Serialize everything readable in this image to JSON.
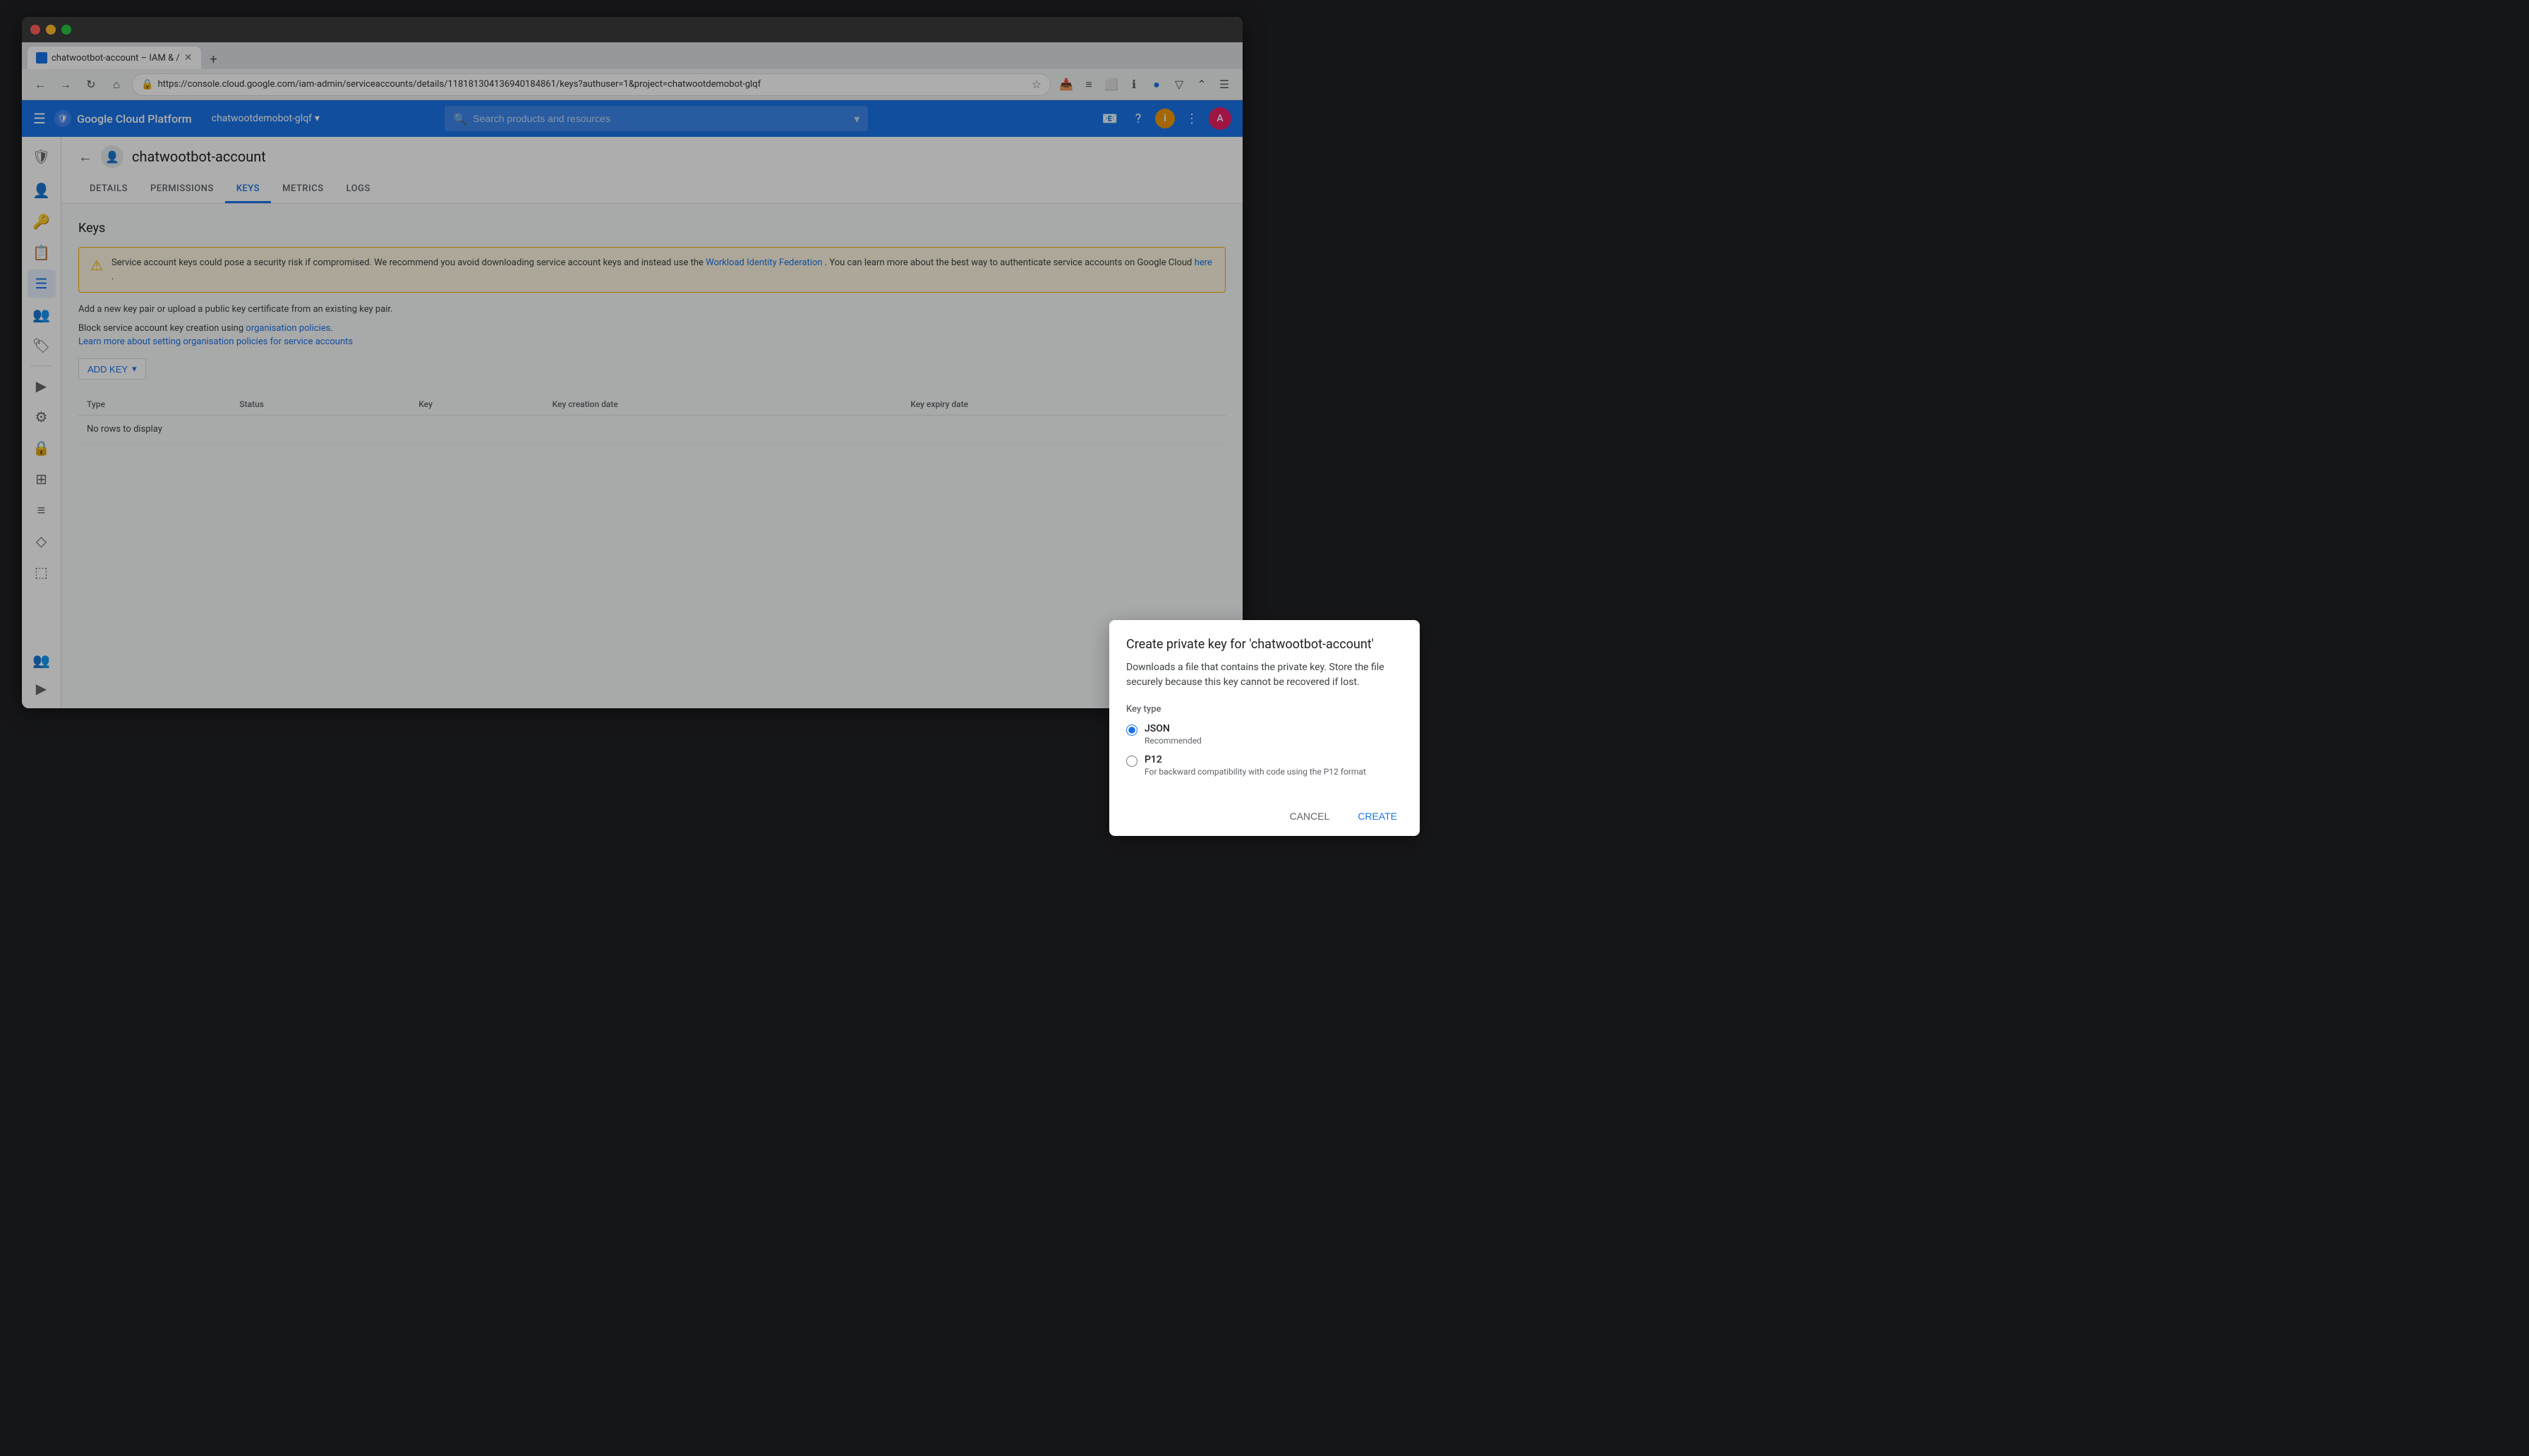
{
  "browser": {
    "tab_title": "chatwootbot-account – IAM &  /",
    "url": "https://console.cloud.google.com/iam-admin/serviceaccounts/details/118181304136940184861/keys?authuser=1&project=chatwootdemobot-glqf"
  },
  "topnav": {
    "app_name": "Google Cloud Platform",
    "project_name": "chatwootdemobot-glqf",
    "search_placeholder": "Search products and resources",
    "hamburger_label": "☰"
  },
  "page": {
    "title": "chatwootbot-account",
    "back_label": "←"
  },
  "tabs": {
    "items": [
      {
        "id": "details",
        "label": "DETAILS"
      },
      {
        "id": "permissions",
        "label": "PERMISSIONS"
      },
      {
        "id": "keys",
        "label": "KEYS"
      },
      {
        "id": "metrics",
        "label": "METRICS"
      },
      {
        "id": "logs",
        "label": "LOGS"
      }
    ],
    "active": "keys"
  },
  "keys_page": {
    "title": "Keys",
    "warning_text": "Service account keys could pose a security risk if compromised. We recommend you avoid downloading service account keys and instead use the ",
    "workload_identity_link": "Workload Identity Federation",
    "warning_text2": ". You can learn more about the best way to authenticate service accounts on Google Cloud ",
    "here_link": "here",
    "warning_text3": ".",
    "add_key_desc": "Add a new key pair or upload a public key certificate from an existing key pair.",
    "block_policy_text": "Block service account key creation using ",
    "org_policy_link": "organisation policies",
    "learn_more_text": "Learn more about setting organisation policies for service accounts",
    "add_key_label": "ADD KEY",
    "table_columns": [
      "Type",
      "Status",
      "Key",
      "Key creation date",
      "Key expiry date"
    ],
    "no_rows_text": "No rows to display"
  },
  "dialog": {
    "title": "Create private key for 'chatwootbot-account'",
    "description": "Downloads a file that contains the private key. Store the file securely because this key cannot be recovered if lost.",
    "key_type_label": "Key type",
    "options": [
      {
        "id": "json",
        "label": "JSON",
        "hint": "Recommended",
        "selected": true
      },
      {
        "id": "p12",
        "label": "P12",
        "hint": "For backward compatibility with code using the P12 format",
        "selected": false
      }
    ],
    "cancel_label": "CANCEL",
    "create_label": "CREATE"
  },
  "sidebar": {
    "icons": [
      {
        "id": "iam",
        "symbol": "🛡",
        "active": true
      },
      {
        "id": "account",
        "symbol": "👤"
      },
      {
        "id": "key",
        "symbol": "🔑"
      },
      {
        "id": "document",
        "symbol": "📄"
      },
      {
        "id": "list",
        "symbol": "☰"
      },
      {
        "id": "people",
        "symbol": "👥"
      },
      {
        "id": "tag",
        "symbol": "🏷"
      },
      {
        "id": "arrow",
        "symbol": "▶"
      },
      {
        "id": "settings",
        "symbol": "⚙"
      },
      {
        "id": "security",
        "symbol": "🔒"
      },
      {
        "id": "grid",
        "symbol": "⊞"
      },
      {
        "id": "layers",
        "symbol": "≡"
      },
      {
        "id": "diamond",
        "symbol": "◈"
      },
      {
        "id": "terminal",
        "symbol": "⬚"
      },
      {
        "id": "users",
        "symbol": "👥"
      }
    ]
  }
}
